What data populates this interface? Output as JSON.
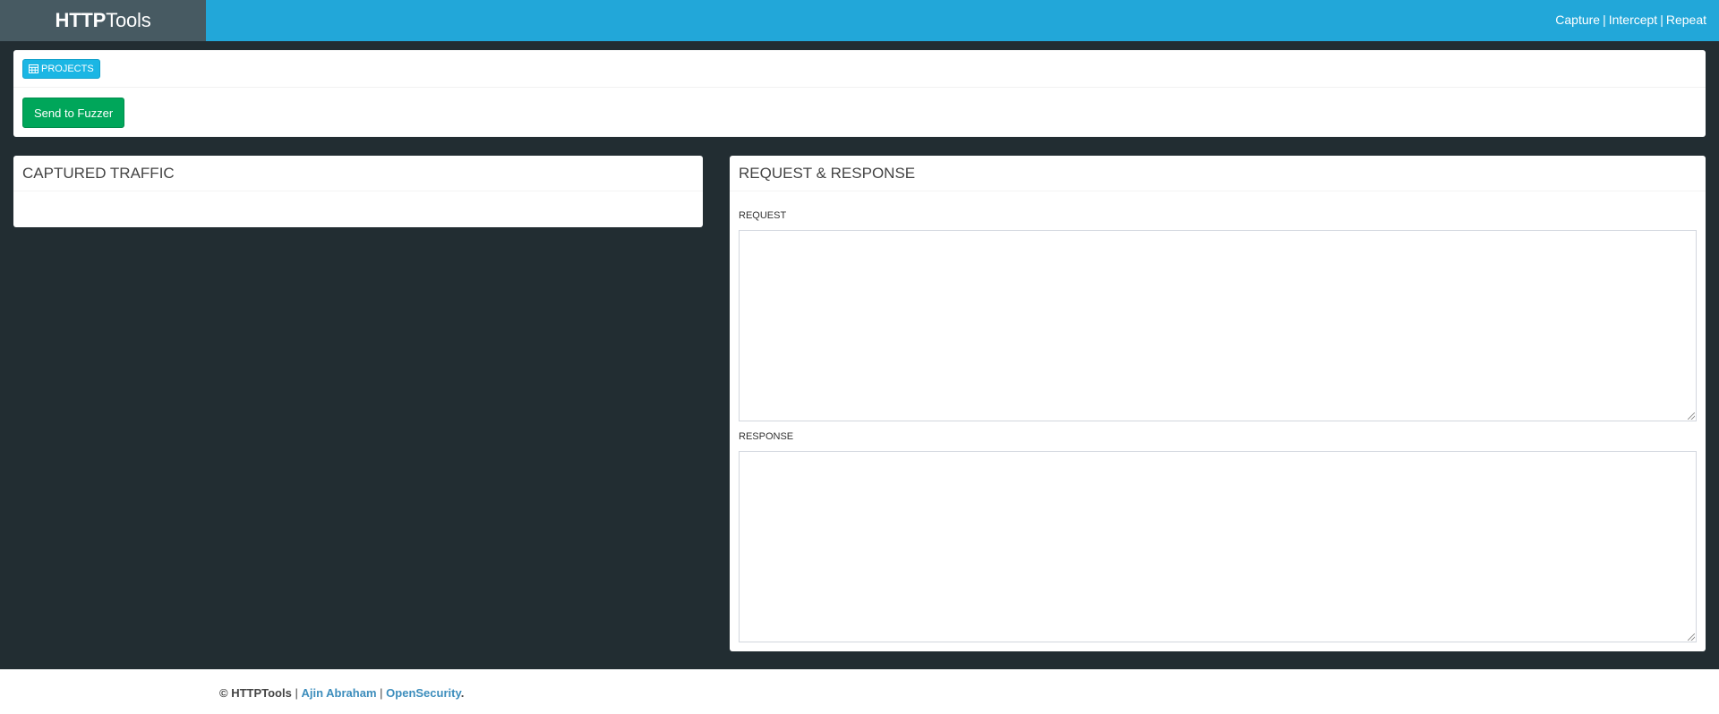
{
  "header": {
    "logo_bold": "HTTP",
    "logo_light": "Tools",
    "nav": [
      {
        "label": "Capture"
      },
      {
        "label": "Intercept"
      },
      {
        "label": "Repeat"
      }
    ],
    "separator": "|",
    "bg_color": "#22a7d9",
    "logo_bg": "#475a62"
  },
  "toolbar": {
    "projects_label": "PROJECTS",
    "fuzzer_label": "Send to Fuzzer"
  },
  "traffic": {
    "title": "CAPTURED TRAFFIC"
  },
  "reqres": {
    "title": "REQUEST & RESPONSE",
    "request_label": "REQUEST",
    "response_label": "RESPONSE",
    "request_value": "",
    "response_value": ""
  },
  "footer": {
    "copyright": "© HTTPTools",
    "sep": "|",
    "author": "Ajin Abraham",
    "org": "OpenSecurity",
    "end": "."
  }
}
